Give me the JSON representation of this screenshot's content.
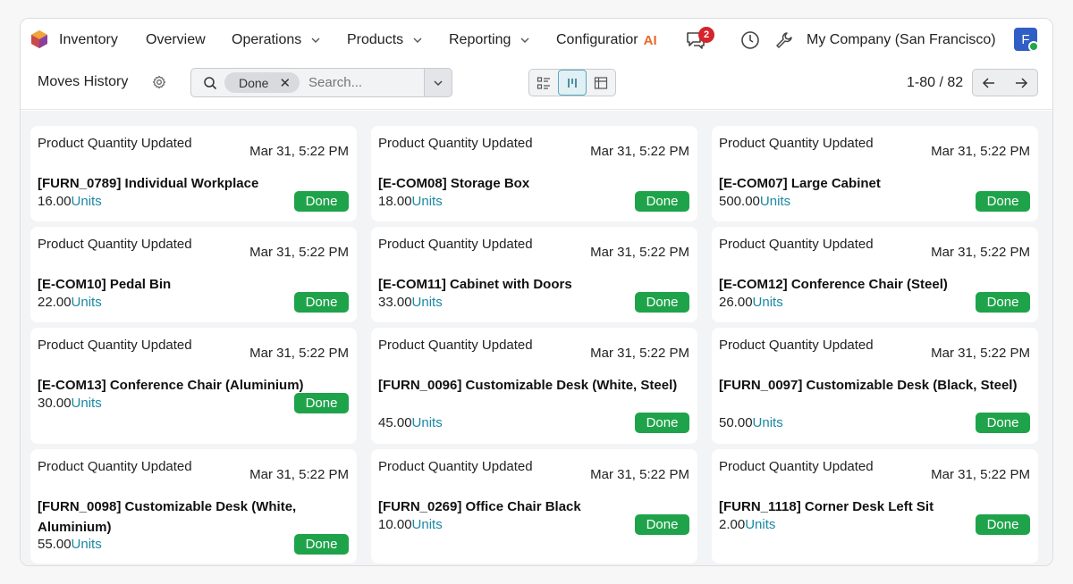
{
  "navbar": {
    "app_name": "Inventory",
    "items": [
      {
        "label": "Overview",
        "dropdown": false
      },
      {
        "label": "Operations",
        "dropdown": true
      },
      {
        "label": "Products",
        "dropdown": true
      },
      {
        "label": "Reporting",
        "dropdown": true
      },
      {
        "label": "Configuratior",
        "dropdown": false
      }
    ],
    "ai_icon": "AI",
    "chat_badge_count": "2",
    "company": "My Company (San Francisco)",
    "avatar_initial": "F",
    "colors": {
      "avatar": "#2f5fc4",
      "badge": "#d5242a",
      "online": "#1fa843"
    }
  },
  "control": {
    "title": "Moves History",
    "search": {
      "facet": "Done",
      "placeholder": "Search..."
    },
    "pager": "1-80 / 82"
  },
  "cards": [
    {
      "title": "Product Quantity Updated",
      "date": "Mar 31, 5:22 PM",
      "product": "[FURN_0789] Individual Workplace",
      "qty": "16.00",
      "unit": "Units",
      "status": "Done"
    },
    {
      "title": "Product Quantity Updated",
      "date": "Mar 31, 5:22 PM",
      "product": "[E-COM08] Storage Box",
      "qty": "18.00",
      "unit": "Units",
      "status": "Done"
    },
    {
      "title": "Product Quantity Updated",
      "date": "Mar 31, 5:22 PM",
      "product": "[E-COM07] Large Cabinet",
      "qty": "500.00",
      "unit": "Units",
      "status": "Done"
    },
    {
      "title": "Product Quantity Updated",
      "date": "Mar 31, 5:22 PM",
      "product": "[E-COM10] Pedal Bin",
      "qty": "22.00",
      "unit": "Units",
      "status": "Done"
    },
    {
      "title": "Product Quantity Updated",
      "date": "Mar 31, 5:22 PM",
      "product": "[E-COM11] Cabinet with Doors",
      "qty": "33.00",
      "unit": "Units",
      "status": "Done"
    },
    {
      "title": "Product Quantity Updated",
      "date": "Mar 31, 5:22 PM",
      "product": "[E-COM12] Conference Chair (Steel)",
      "qty": "26.00",
      "unit": "Units",
      "status": "Done"
    },
    {
      "title": "Product Quantity Updated",
      "date": "Mar 31, 5:22 PM",
      "product": "[E-COM13] Conference Chair (Aluminium)",
      "qty": "30.00",
      "unit": "Units",
      "status": "Done"
    },
    {
      "title": "Product Quantity Updated",
      "date": "Mar 31, 5:22 PM",
      "product": "[FURN_0096] Customizable Desk (White, Steel)",
      "qty": "45.00",
      "unit": "Units",
      "status": "Done"
    },
    {
      "title": "Product Quantity Updated",
      "date": "Mar 31, 5:22 PM",
      "product": "[FURN_0097] Customizable Desk (Black, Steel)",
      "qty": "50.00",
      "unit": "Units",
      "status": "Done"
    },
    {
      "title": "Product Quantity Updated",
      "date": "Mar 31, 5:22 PM",
      "product": "[FURN_0098] Customizable Desk (White, Aluminium)",
      "qty": "55.00",
      "unit": "Units",
      "status": "Done"
    },
    {
      "title": "Product Quantity Updated",
      "date": "Mar 31, 5:22 PM",
      "product": "[FURN_0269] Office Chair Black",
      "qty": "10.00",
      "unit": "Units",
      "status": "Done"
    },
    {
      "title": "Product Quantity Updated",
      "date": "Mar 31, 5:22 PM",
      "product": "[FURN_1118] Corner Desk Left Sit",
      "qty": "2.00",
      "unit": "Units",
      "status": "Done"
    }
  ],
  "colors": {
    "done": "#1fa34a",
    "unit_link": "#1a88a3",
    "active_view": "#5aa9bd"
  }
}
